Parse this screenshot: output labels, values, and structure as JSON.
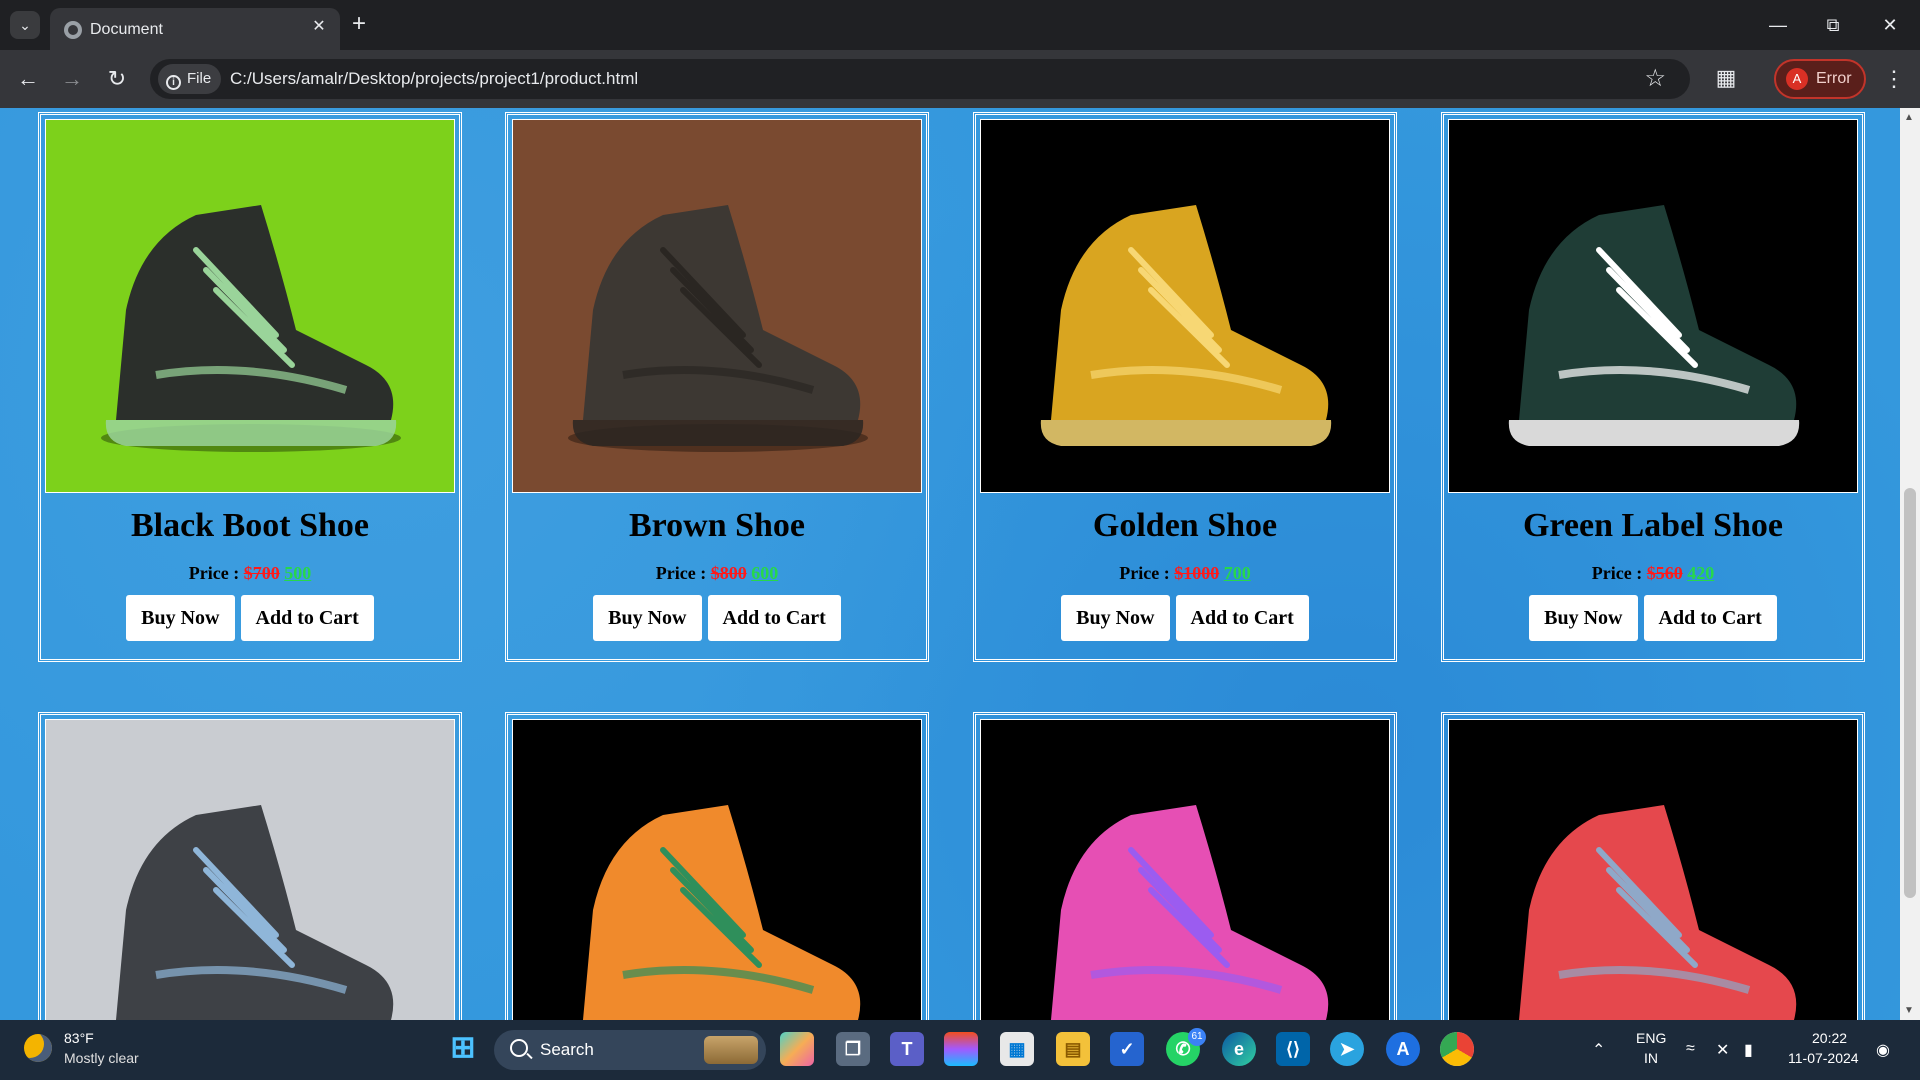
{
  "browser": {
    "tab_title": "Document",
    "new_tab_symbol": "+",
    "site_chip": "File",
    "url": "C:/Users/amalr/Desktop/projects/project1/product.html",
    "profile_initial": "A",
    "profile_status": "Error",
    "icons": [
      "tab-search-icon",
      "globe-icon",
      "close-icon",
      "back-arrow-icon",
      "forward-arrow-icon",
      "reload-icon",
      "info-icon",
      "star-icon",
      "extensions-icon",
      "more-vert-icon",
      "minimize-icon",
      "restore-icon",
      "close-window-icon"
    ]
  },
  "products": [
    {
      "name": "Black Boot Shoe",
      "price_label": "Price :",
      "old_price": "$700",
      "new_price": "500",
      "buy_label": "Buy Now",
      "cart_label": "Add to Cart",
      "image": {
        "bg": "#7dd11b",
        "shoe": "#2b2f2b",
        "accent": "#9ad49a"
      }
    },
    {
      "name": "Brown Shoe",
      "price_label": "Price :",
      "old_price": "$800",
      "new_price": "600",
      "buy_label": "Buy Now",
      "cart_label": "Add to Cart",
      "image": {
        "bg": "#7a4a30",
        "shoe": "#3d3833",
        "accent": "#2a2622"
      }
    },
    {
      "name": "Golden Shoe",
      "price_label": "Price :",
      "old_price": "$1000",
      "new_price": "700",
      "buy_label": "Buy Now",
      "cart_label": "Add to Cart",
      "image": {
        "bg": "#000000",
        "shoe": "#d9a520",
        "accent": "#f7d774"
      }
    },
    {
      "name": "Green Label Shoe",
      "price_label": "Price :",
      "old_price": "$560",
      "new_price": "420",
      "buy_label": "Buy Now",
      "cart_label": "Add to Cart",
      "image": {
        "bg": "#000000",
        "shoe": "#1f3d36",
        "accent": "#ffffff"
      }
    },
    {
      "image": {
        "bg": "#c9ccd1",
        "shoe": "#3e4146",
        "accent": "#8fb6d9"
      }
    },
    {
      "image": {
        "bg": "#000000",
        "shoe": "#f08a2c",
        "accent": "#2f8f5b"
      }
    },
    {
      "image": {
        "bg": "#000000",
        "shoe": "#e64fb4",
        "accent": "#9b5cf0"
      }
    },
    {
      "image": {
        "bg": "#000000",
        "shoe": "#e5484d",
        "accent": "#8fa8c8"
      }
    }
  ],
  "colors": {
    "page_bg": "#3498dd",
    "old_price": "#ff1a1a",
    "new_price": "#27d84a"
  },
  "taskbar": {
    "weather_temp": "83°F",
    "weather_desc": "Mostly clear",
    "search_label": "Search",
    "whatsapp_badge": "61",
    "lang_top": "ENG",
    "lang_bottom": "IN",
    "time": "20:22",
    "date": "11-07-2024",
    "icons": [
      "windows-start-icon",
      "search-icon",
      "copilot-icon",
      "task-view-icon",
      "teams-icon",
      "figma-icon",
      "ms-store-icon",
      "file-explorer-icon",
      "ms-todo-icon",
      "whatsapp-icon",
      "edge-icon",
      "vscode-icon",
      "telegram-icon",
      "app-store-icon",
      "chrome-icon",
      "chevron-up-icon",
      "wifi-icon",
      "mute-icon",
      "battery-icon",
      "notification-bell-icon"
    ]
  }
}
